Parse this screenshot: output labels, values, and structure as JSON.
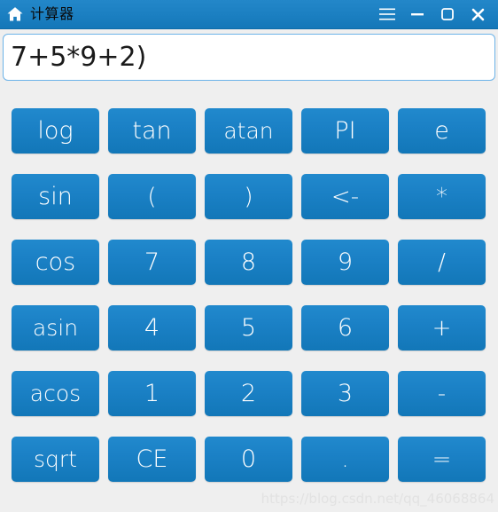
{
  "window": {
    "title": "计算器",
    "icon": "home-icon",
    "titlebar_color": "#1b81c4",
    "controls": [
      {
        "name": "menu-button",
        "icon": "hamburger-menu-icon",
        "label": "☰"
      },
      {
        "name": "minimize-button",
        "icon": "minimize-icon",
        "label": "–"
      },
      {
        "name": "maximize-button",
        "icon": "maximize-icon",
        "label": "□"
      },
      {
        "name": "close-button",
        "icon": "close-icon",
        "label": "✕"
      }
    ]
  },
  "display": {
    "value": "7+5*9+2)",
    "placeholder": "",
    "border_color": "#6cb3e8",
    "background": "#ffffff"
  },
  "keypad": {
    "button_color": "#1b81c6",
    "button_text_color": "#ffffff",
    "rows": [
      [
        {
          "name": "key-log",
          "label": "log",
          "kind": "func"
        },
        {
          "name": "key-tan",
          "label": "tan",
          "kind": "func"
        },
        {
          "name": "key-atan",
          "label": "atan",
          "kind": "func"
        },
        {
          "name": "key-pi",
          "label": "PI",
          "kind": "const"
        },
        {
          "name": "key-e",
          "label": "e",
          "kind": "const"
        }
      ],
      [
        {
          "name": "key-sin",
          "label": "sin",
          "kind": "func"
        },
        {
          "name": "key-paren-open",
          "label": "(",
          "kind": "op"
        },
        {
          "name": "key-paren-close",
          "label": ")",
          "kind": "op"
        },
        {
          "name": "key-backspace",
          "label": "<-",
          "kind": "op"
        },
        {
          "name": "key-multiply",
          "label": "*",
          "kind": "op"
        }
      ],
      [
        {
          "name": "key-cos",
          "label": "cos",
          "kind": "func"
        },
        {
          "name": "key-7",
          "label": "7",
          "kind": "digit"
        },
        {
          "name": "key-8",
          "label": "8",
          "kind": "digit"
        },
        {
          "name": "key-9",
          "label": "9",
          "kind": "digit"
        },
        {
          "name": "key-divide",
          "label": "/",
          "kind": "op"
        }
      ],
      [
        {
          "name": "key-asin",
          "label": "asin",
          "kind": "func"
        },
        {
          "name": "key-4",
          "label": "4",
          "kind": "digit"
        },
        {
          "name": "key-5",
          "label": "5",
          "kind": "digit"
        },
        {
          "name": "key-6",
          "label": "6",
          "kind": "digit"
        },
        {
          "name": "key-plus",
          "label": "+",
          "kind": "op"
        }
      ],
      [
        {
          "name": "key-acos",
          "label": "acos",
          "kind": "func"
        },
        {
          "name": "key-1",
          "label": "1",
          "kind": "digit"
        },
        {
          "name": "key-2",
          "label": "2",
          "kind": "digit"
        },
        {
          "name": "key-3",
          "label": "3",
          "kind": "digit"
        },
        {
          "name": "key-minus",
          "label": "-",
          "kind": "op"
        }
      ],
      [
        {
          "name": "key-sqrt",
          "label": "sqrt",
          "kind": "func"
        },
        {
          "name": "key-clear",
          "label": "CE",
          "kind": "func"
        },
        {
          "name": "key-0",
          "label": "0",
          "kind": "digit"
        },
        {
          "name": "key-decimal",
          "label": ".",
          "kind": "op"
        },
        {
          "name": "key-equals",
          "label": "=",
          "kind": "op"
        }
      ]
    ]
  },
  "watermark": {
    "text": "https://blog.csdn.net/qq_46068864"
  }
}
